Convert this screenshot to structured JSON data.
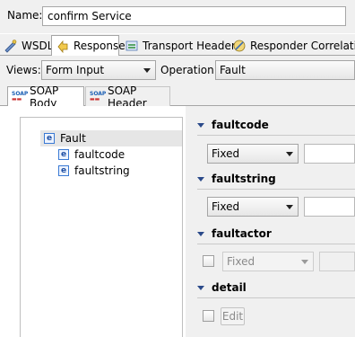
{
  "name_label": "Name:",
  "name_value": "confirm Service",
  "main_tabs": [
    {
      "label": "WSDL",
      "icon": "wsdl-icon"
    },
    {
      "label": "Response",
      "icon": "response-icon",
      "active": true
    },
    {
      "label": "Transport Header",
      "icon": "transport-header-icon"
    },
    {
      "label": "Responder Correlation",
      "icon": "responder-correlation-icon"
    }
  ],
  "views_label": "Views:",
  "views_value": "Form Input",
  "operation_label": "Operation:",
  "operation_value": "Fault",
  "sub_tabs": [
    {
      "label": "SOAP Body",
      "icon": "soap-icon",
      "active": true
    },
    {
      "label": "SOAP Header",
      "icon": "soap-icon"
    }
  ],
  "tree": {
    "root": "Fault",
    "children": [
      "faultcode",
      "faultstring"
    ]
  },
  "sections": {
    "faultcode": {
      "title": "faultcode",
      "select": "Fixed"
    },
    "faultstring": {
      "title": "faultstring",
      "select": "Fixed"
    },
    "faultactor": {
      "title": "faultactor",
      "select": "Fixed"
    },
    "detail": {
      "title": "detail",
      "button": "Edit"
    }
  },
  "colors": {
    "accent": "#2b4a8a",
    "selection": "#e6e6e6"
  }
}
